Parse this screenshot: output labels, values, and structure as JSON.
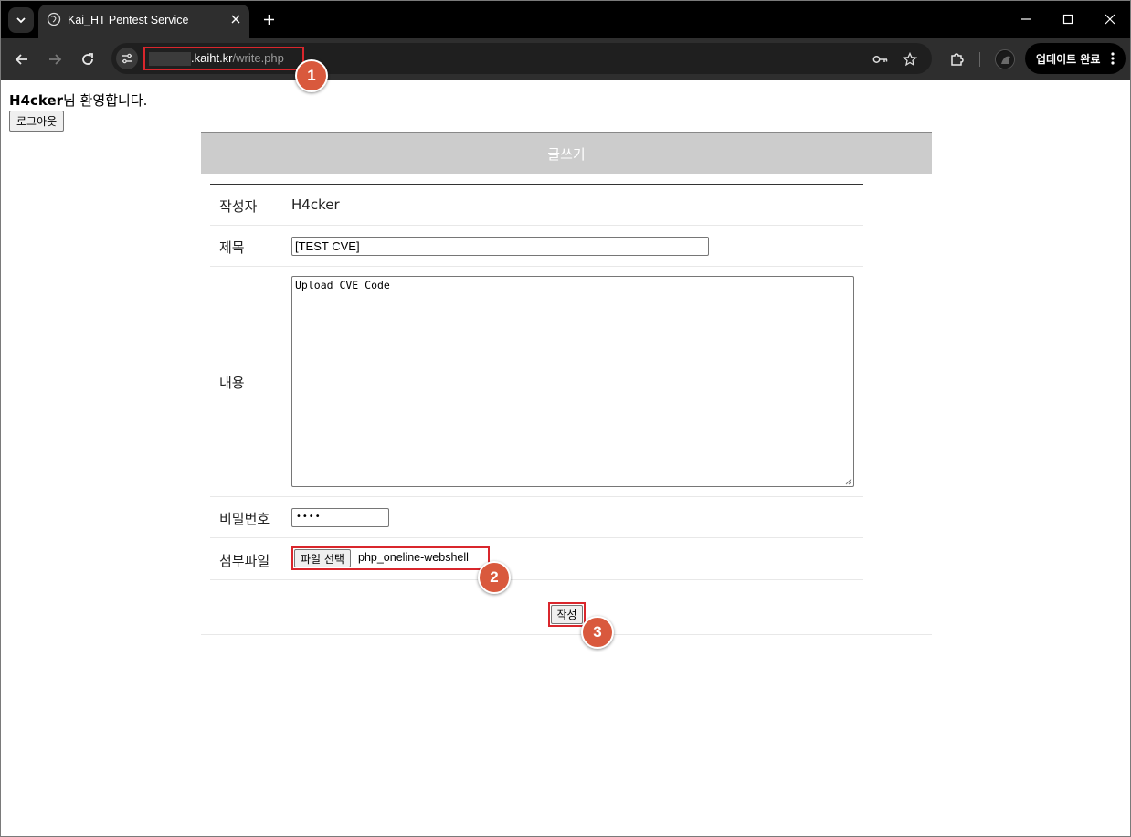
{
  "browser": {
    "tab_title": "Kai_HT Pentest Service",
    "url_host": ".kaiht.kr",
    "url_path": "/write.php",
    "update_label": "업데이트 완료"
  },
  "page": {
    "welcome_user": "H4cker",
    "welcome_suffix": "님 환영합니다.",
    "logout_label": "로그아웃",
    "board_title": "글쓰기",
    "form": {
      "author_label": "작성자",
      "author_value": "H4cker",
      "title_label": "제목",
      "title_value": "[TEST CVE]",
      "content_label": "내용",
      "content_value": "Upload CVE Code",
      "password_label": "비밀번호",
      "password_mask": "••••",
      "attach_label": "첨부파일",
      "file_button_label": "파일 선택",
      "file_name": "php_oneline-webshell",
      "submit_label": "작성"
    }
  },
  "annotations": {
    "step1": "1",
    "step2": "2",
    "step3": "3",
    "highlight_color": "#d9262c",
    "badge_color": "#d9593d"
  }
}
